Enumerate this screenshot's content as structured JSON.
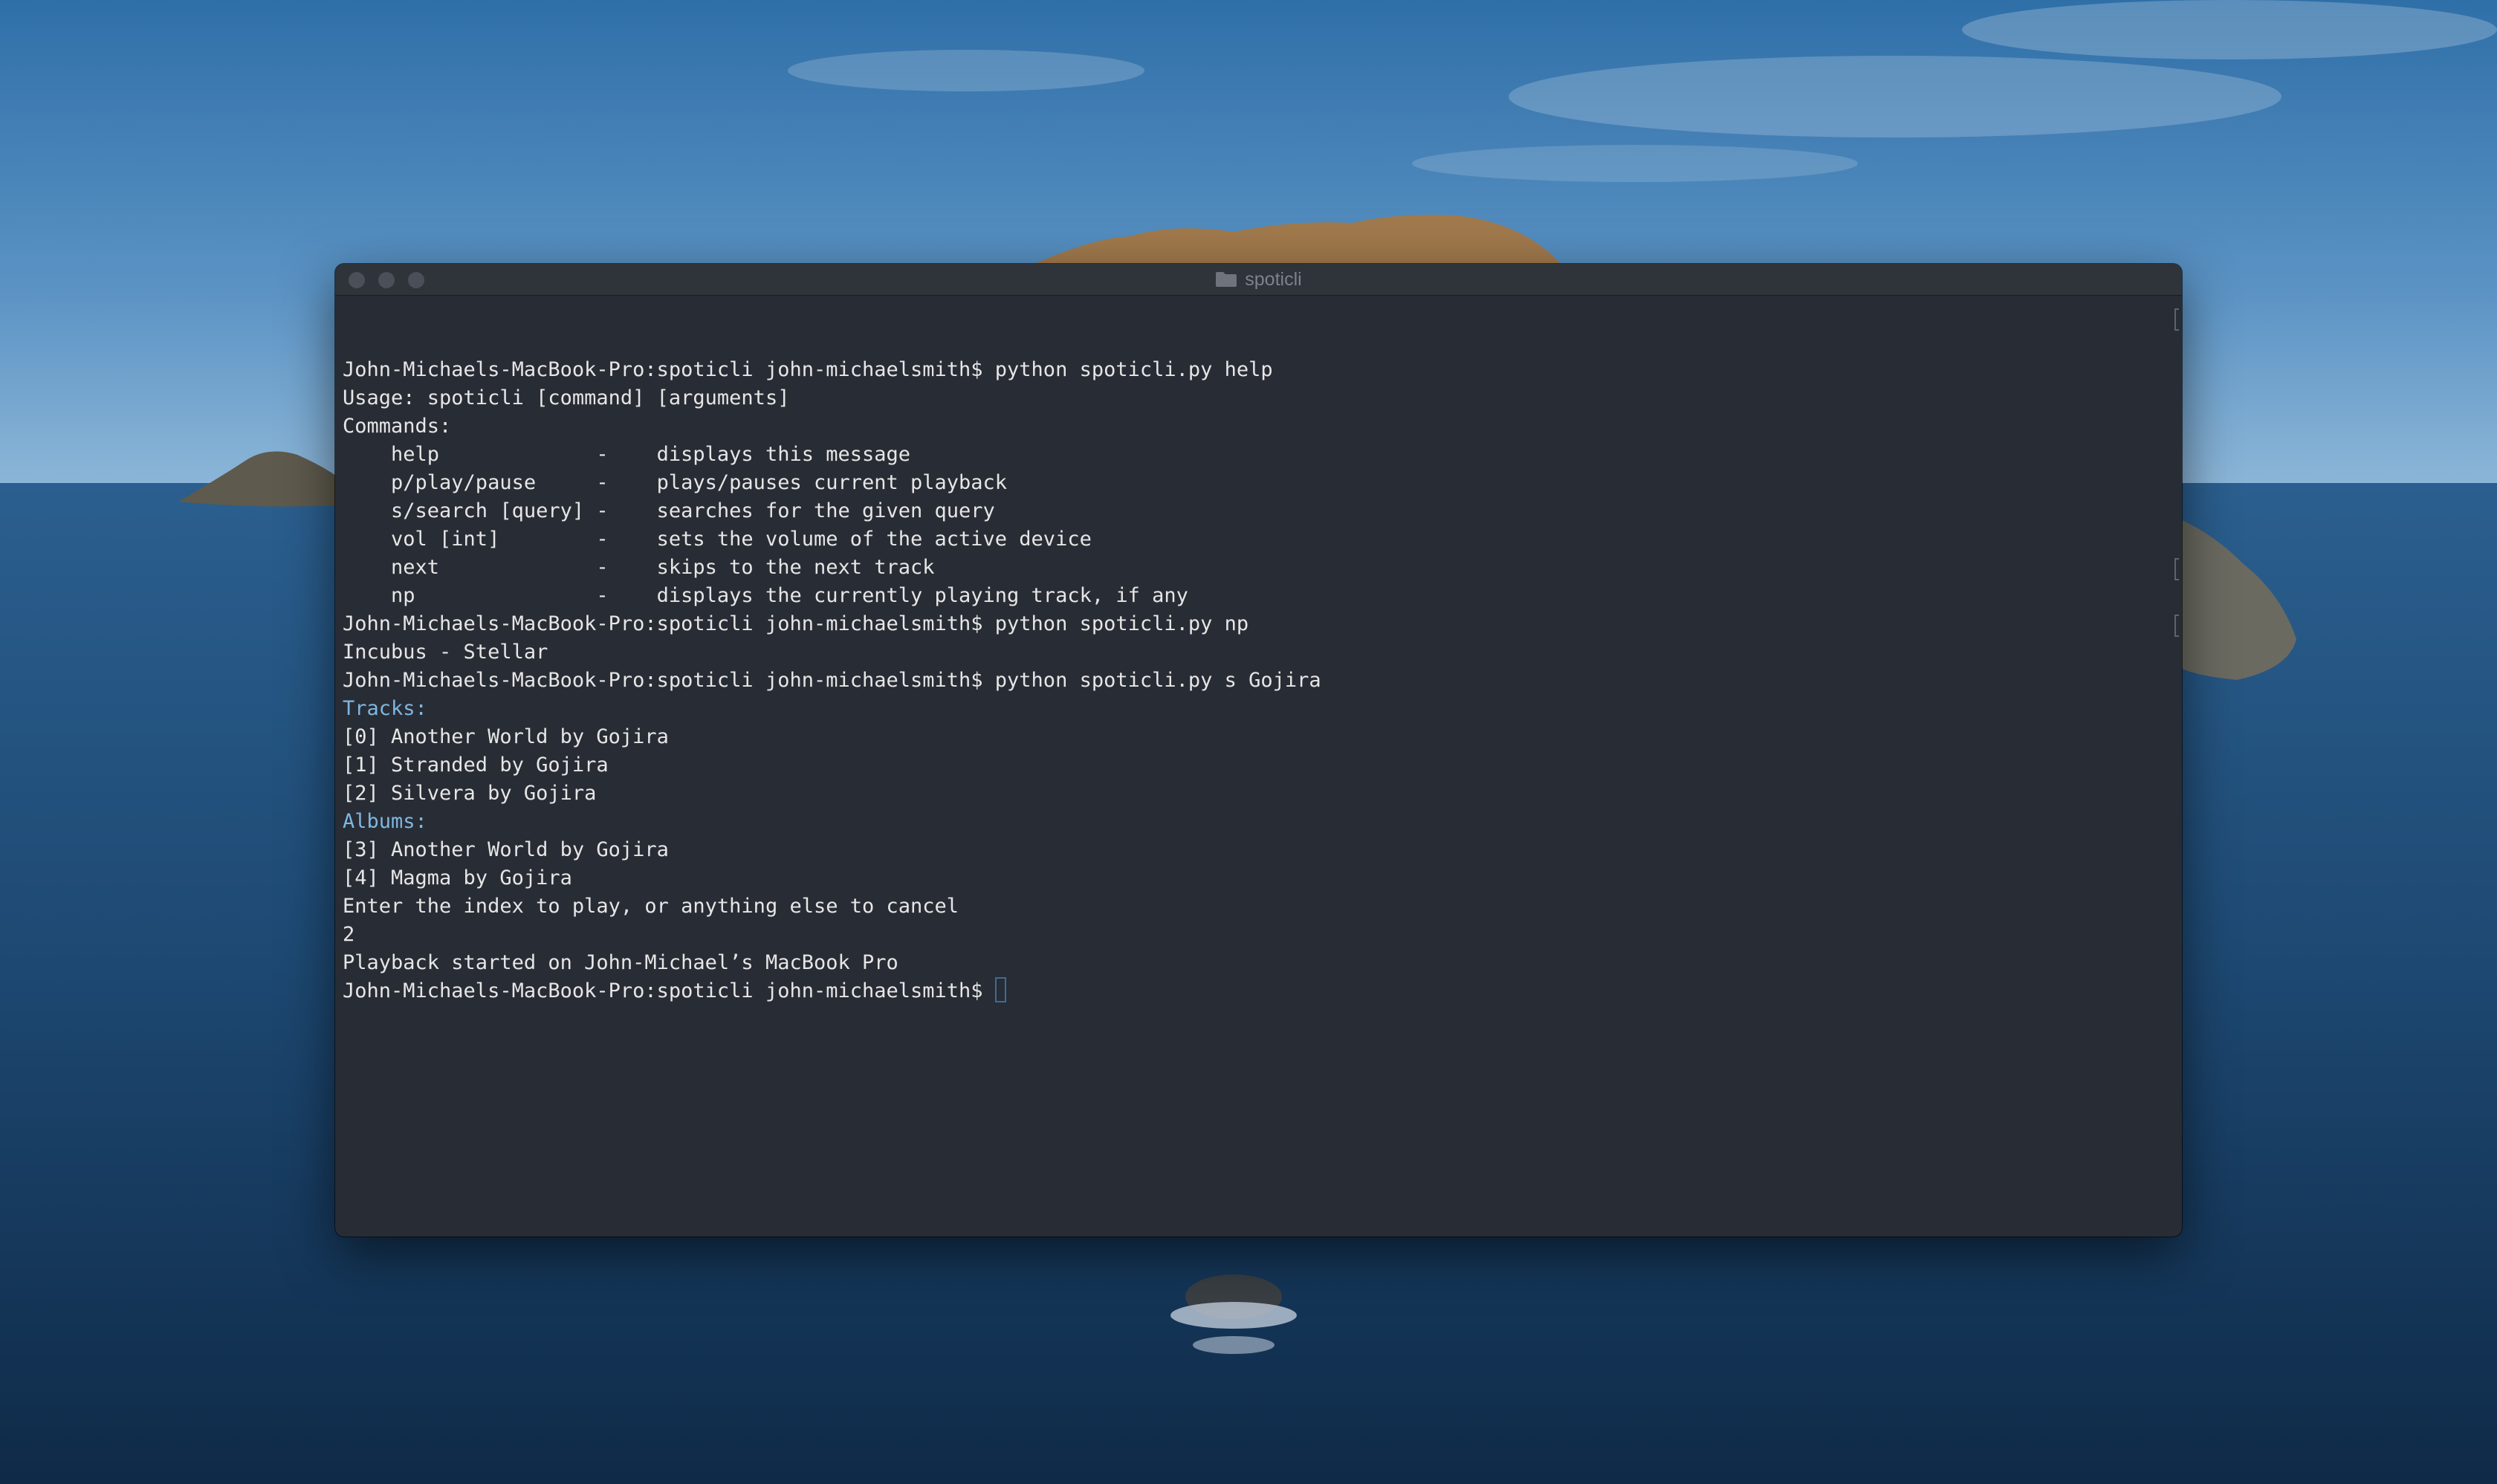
{
  "window": {
    "title": "spoticli"
  },
  "terminal": {
    "prompt": "John-Michaels-MacBook-Pro:spoticli john-michaelsmith$",
    "lines": [
      {
        "text": "John-Michaels-MacBook-Pro:spoticli john-michaelsmith$ python spoticli.py help"
      },
      {
        "text": "Usage: spoticli [command] [arguments]"
      },
      {
        "text": "Commands:"
      },
      {
        "text": "    help             -    displays this message"
      },
      {
        "text": "    p/play/pause     -    plays/pauses current playback"
      },
      {
        "text": "    s/search [query] -    searches for the given query"
      },
      {
        "text": "    vol [int]        -    sets the volume of the active device"
      },
      {
        "text": "    next             -    skips to the next track"
      },
      {
        "text": "    np               -    displays the currently playing track, if any"
      },
      {
        "text": "John-Michaels-MacBook-Pro:spoticli john-michaelsmith$ python spoticli.py np"
      },
      {
        "text": "Incubus - Stellar"
      },
      {
        "text": "John-Michaels-MacBook-Pro:spoticli john-michaelsmith$ python spoticli.py s Gojira"
      },
      {
        "text": "Tracks:",
        "heading": true
      },
      {
        "text": "[0] Another World by Gojira"
      },
      {
        "text": "[1] Stranded by Gojira"
      },
      {
        "text": "[2] Silvera by Gojira"
      },
      {
        "text": "Albums:",
        "heading": true
      },
      {
        "text": "[3] Another World by Gojira"
      },
      {
        "text": "[4] Magma by Gojira"
      },
      {
        "text": "Enter the index to play, or anything else to cancel"
      },
      {
        "text": "2"
      },
      {
        "text": "Playback started on John-Michael’s MacBook Pro"
      }
    ]
  },
  "colors": {
    "terminal_bg": "#282c34",
    "text": "#e6e6e6",
    "heading": "#7fb7e2",
    "cursor": "#3c6d96"
  }
}
